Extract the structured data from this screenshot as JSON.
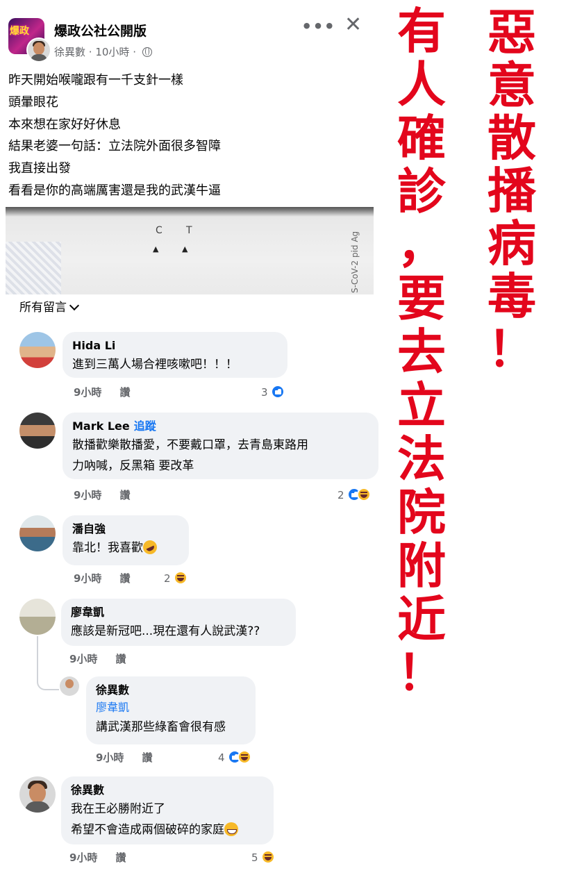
{
  "post": {
    "group_name": "爆政公社公開版",
    "poster": "徐異數",
    "meta_time": "· 10小時 ·",
    "logo_text": "爆政",
    "lines": [
      "昨天開始喉嚨跟有一千支針一樣",
      "頭暈眼花",
      "本來想在家好好休息",
      "結果老婆一句話：立法院外面很多智障",
      "我直接出發",
      "看看是你的高端厲害還是我的武漢牛逼"
    ],
    "image_marks": {
      "c": "C",
      "t": "T",
      "side_text": "S-CoV-2 pid Ag"
    },
    "filter_label": "所有留言"
  },
  "comments": [
    {
      "name": "Hida Li",
      "text": [
        "進到三萬人場合裡咳嗽吧！！！"
      ],
      "time": "9小時",
      "like": "讚",
      "react_count": "3"
    },
    {
      "name": "Mark Lee",
      "follow": "追蹤",
      "text": [
        "散播歡樂散播愛，不要戴口罩，去青島東路用",
        "力吶喊，反黑箱 要改革"
      ],
      "time": "9小時",
      "like": "讚",
      "react_count": "2"
    },
    {
      "name": "潘自強",
      "text": [
        "靠北！我喜歡"
      ],
      "time": "9小時",
      "like": "讚",
      "react_count": "2"
    },
    {
      "name": "廖韋凱",
      "text": [
        "應該是新冠吧...現在還有人說武漢??"
      ],
      "time": "9小時",
      "like": "讚"
    },
    {
      "name": "徐異數",
      "mention": "廖韋凱",
      "text": [
        "講武漢那些綠畜會很有感"
      ],
      "time": "9小時",
      "like": "讚",
      "react_count": "4"
    },
    {
      "name": "徐異數",
      "text": [
        "我在王必勝附近了",
        "希望不會造成兩個破碎的家庭"
      ],
      "time": "9小時",
      "like": "讚",
      "react_count": "5"
    }
  ],
  "banner_right": [
    "惡",
    "意",
    "散",
    "播",
    "病",
    "毒",
    "！"
  ],
  "banner_mid": [
    "有",
    "人",
    "確",
    "診",
    "，",
    "要",
    "去",
    "立",
    "法",
    "院",
    "附",
    "近",
    "！"
  ],
  "colors": {
    "banner": "#e3061c",
    "link": "#1877f2",
    "bubble": "#f0f2f5"
  },
  "icons": [
    "more-icon",
    "close-icon",
    "globe-icon",
    "like-icon",
    "haha-icon",
    "chevron-down-icon"
  ]
}
